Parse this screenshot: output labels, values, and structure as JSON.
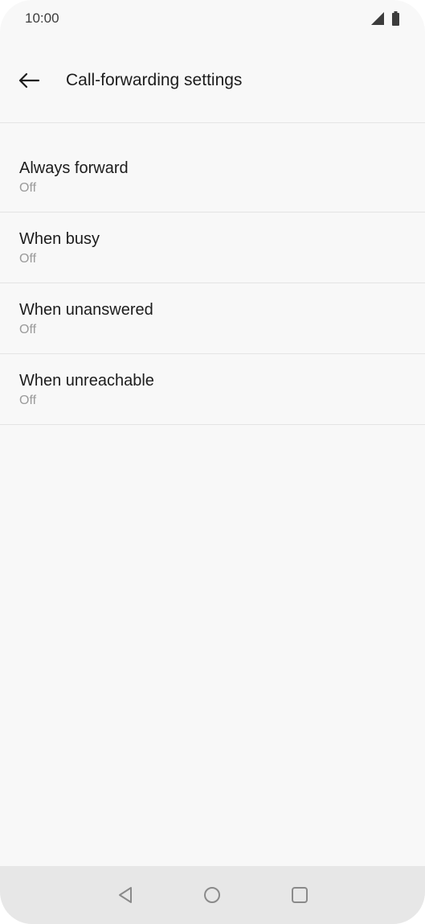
{
  "status_bar": {
    "time": "10:00",
    "icons": [
      "signal-icon",
      "battery-icon"
    ]
  },
  "header": {
    "back_icon": "arrow-left-icon",
    "title": "Call-forwarding settings"
  },
  "settings": {
    "items": [
      {
        "label": "Always forward",
        "status": "Off"
      },
      {
        "label": "When busy",
        "status": "Off"
      },
      {
        "label": "When unanswered",
        "status": "Off"
      },
      {
        "label": "When unreachable",
        "status": "Off"
      }
    ]
  },
  "nav_bar": {
    "buttons": [
      "back-triangle-icon",
      "home-circle-icon",
      "recents-square-icon"
    ]
  },
  "colors": {
    "background": "#f8f8f8",
    "nav_background": "#e7e7e7",
    "text_primary": "#1c1c1c",
    "text_secondary": "#9a9a9a",
    "divider": "#e4e4e4"
  }
}
